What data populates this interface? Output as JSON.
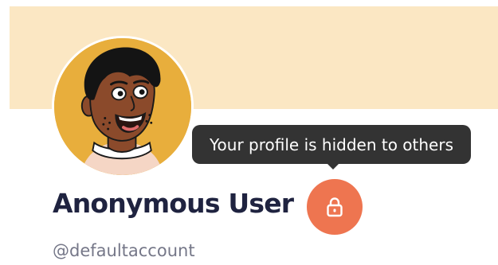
{
  "profile": {
    "display_name": "Anonymous User",
    "username": "@defaultaccount"
  },
  "privacy": {
    "tooltip": "Your profile is hidden to others",
    "lock_icon": "lock-icon"
  },
  "avatar": {
    "icon": "person-avatar"
  },
  "colors": {
    "banner": "#fbe7c3",
    "avatar_background": "#e8ae3c",
    "lock_button": "#ee7550",
    "tooltip_background": "#333333",
    "name_text": "#1f2340",
    "username_text": "#757788"
  }
}
